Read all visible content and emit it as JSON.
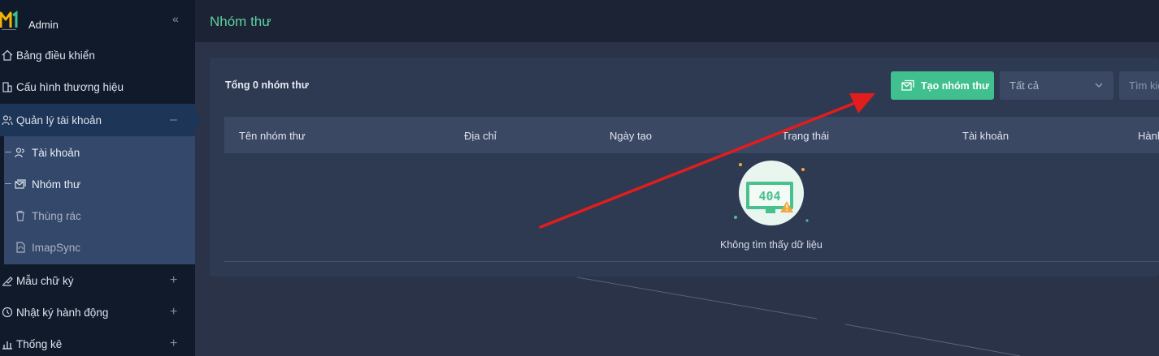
{
  "brand": {
    "name": "Admin",
    "logo_text": "M"
  },
  "sidebar": {
    "items": [
      {
        "label": "Bảng điều khiển",
        "icon": "home-icon"
      },
      {
        "label": "Cấu hình thương hiệu",
        "icon": "building-icon"
      },
      {
        "label": "Quản lý tài khoản",
        "icon": "users-icon",
        "toggle": "–"
      },
      {
        "label": "Mẫu chữ ký",
        "icon": "signature-icon",
        "toggle": "+"
      },
      {
        "label": "Nhật ký hành động",
        "icon": "history-icon",
        "toggle": "+"
      },
      {
        "label": "Thống kê",
        "icon": "chart-icon",
        "toggle": "+"
      }
    ],
    "submenu": [
      {
        "label": "Tài khoản",
        "icon": "user-group-icon"
      },
      {
        "label": "Nhóm thư",
        "icon": "mail-group-icon"
      },
      {
        "label": "Thùng rác",
        "icon": "trash-icon"
      },
      {
        "label": "ImapSync",
        "icon": "sync-icon"
      }
    ]
  },
  "header": {
    "title": "Nhóm thư"
  },
  "toolbar": {
    "total": "Tổng 0 nhóm thư",
    "create_label": "Tạo nhóm thư",
    "filter_value": "Tất cả",
    "search_placeholder": "Tìm kiếm"
  },
  "table": {
    "columns": [
      "Tên nhóm thư",
      "Địa chỉ",
      "Ngày tạo",
      "Trạng thái",
      "Tài khoản",
      "Hành động"
    ],
    "empty_text": "Không tìm thấy dữ liệu",
    "empty_code": "404"
  },
  "colors": {
    "accent": "#3fc08e",
    "title": "#5fd1a0",
    "sidebar_bg": "#111a2b",
    "submenu_bg": "#33486a",
    "annotation_arrow": "#e11d1d"
  }
}
